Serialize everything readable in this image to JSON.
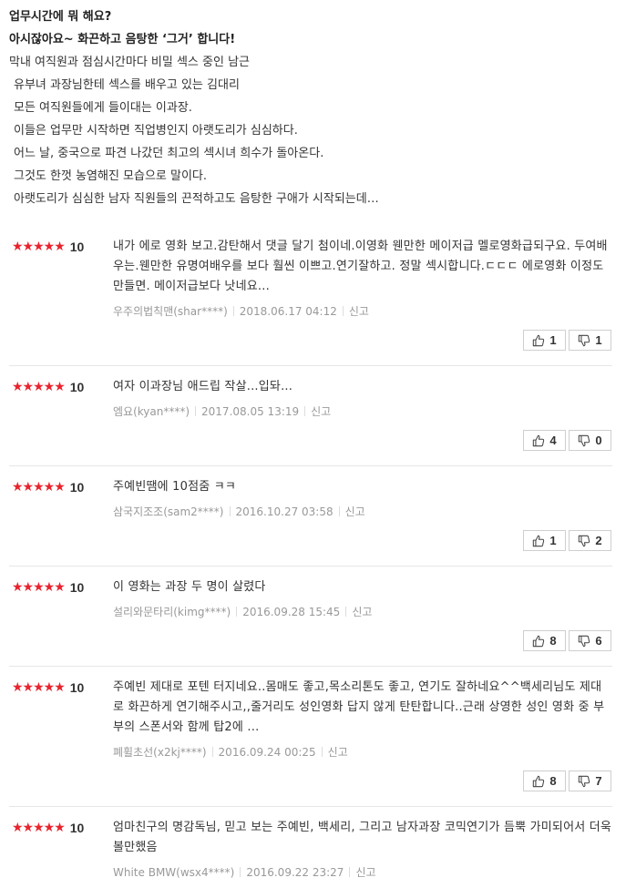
{
  "synopsis": {
    "title1": "업무시간에 뭐 해요?",
    "title2": "아시잖아요~ 화끈하고 음탕한 ‘그거’ 합니다!",
    "lines": [
      "막내 여직원과 점심시간마다 비밀 섹스 중인 남근",
      "유부녀 과장님한테 섹스를 배우고 있는 김대리",
      "모든 여직원들에게 들이대는 이과장.",
      "이들은 업무만 시작하면 직업병인지 아랫도리가 심심하다.",
      "어느 날, 중국으로 파견 나갔던 최고의 섹시녀 희수가 돌아온다.",
      "그것도 한껏 농염해진 모습으로 말이다.",
      "아랫도리가 심심한 남자 직원들의 끈적하고도 음탕한 구애가 시작되는데…"
    ]
  },
  "stars": "★★★★★",
  "report_label": "신고",
  "colors": {
    "star": "#e8232d",
    "meta": "#999999",
    "border": "#cfcfcf"
  },
  "reviews": [
    {
      "score": "10",
      "text": "내가 에로 영화 보고.감탄해서 댓글 달기 첨이네.이영화 웬만한 메이저급 멜로영화급되구요. 두여배우는.웬만한 유명여배우를 보다 훨씬 이쁘고.연기잘하고. 정말 섹시합니다.ㄷㄷㄷ 에로영화 이정도만들면. 메이저급보다 낫네요...",
      "user": "우주의법칙맨(shar****)",
      "date": "2018.06.17 04:12",
      "likes": "1",
      "dislikes": "1"
    },
    {
      "score": "10",
      "text": "여자 이과장님 애드립 작살...입돠...",
      "user": "엠요(kyan****)",
      "date": "2017.08.05 13:19",
      "likes": "4",
      "dislikes": "0"
    },
    {
      "score": "10",
      "text": "주예빈땜에 10점줌 ㅋㅋ",
      "user": "삼국지조조(sam2****)",
      "date": "2016.10.27 03:58",
      "likes": "1",
      "dislikes": "2"
    },
    {
      "score": "10",
      "text": "이 영화는 과장 두 명이 살렸다",
      "user": "설리와문타리(kimg****)",
      "date": "2016.09.28 15:45",
      "likes": "8",
      "dislikes": "6"
    },
    {
      "score": "10",
      "text": "주예빈 제대로 포텐 터지네요..몸매도 좋고,목소리톤도 좋고, 연기도 잘하네요^^백세리님도 제대로 화끈하게 연기해주시고,,줄거리도 성인영화 답지 않게 탄탄합니다..근래 상영한 성인 영화 중 부부의 스폰서와 함께 탑2에 ...",
      "user": "폐휠초선(x2kj****)",
      "date": "2016.09.24 00:25",
      "likes": "8",
      "dislikes": "7"
    },
    {
      "score": "10",
      "text": "엄마친구의 명감독님, 믿고 보는 주예빈, 백세리, 그리고 남자과장 코믹연기가 듬뿍 가미되어서 더욱 볼만했음",
      "user": "White BMW(wsx4****)",
      "date": "2016.09.22 23:27",
      "likes": "",
      "dislikes": ""
    }
  ]
}
